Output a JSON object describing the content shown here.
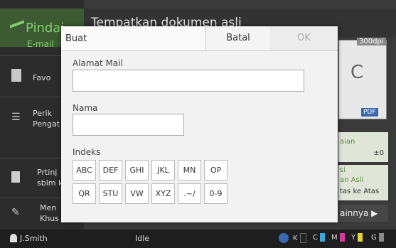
{
  "side": {
    "scan_title": "Pindai",
    "scan_sub": "E-mail",
    "items": [
      {
        "label": "Favo"
      },
      {
        "label": "Perik\nPengat"
      },
      {
        "label": "Prtinj\nsblm k"
      },
      {
        "label": "Men\nKhus"
      }
    ]
  },
  "topbar": {
    "title": "Tempatkan dokumen asli"
  },
  "right": {
    "dpi": "300dpi",
    "pdf": "PDF",
    "box1": "aian",
    "box1_val": "±0",
    "box2_l1": "si",
    "box2_l2": "an Asli",
    "box2_l3": "tas ke Atas",
    "lainnya": "ainnya ▶"
  },
  "status": {
    "user": "J.Smith",
    "state": "Idle",
    "toner": [
      "K",
      "C",
      "M",
      "Y",
      "G"
    ],
    "colors": {
      "K": "#222222",
      "C": "#3ea8d8",
      "M": "#d03aa0",
      "Y": "#e6d23a",
      "G": "#888888"
    }
  },
  "dialog": {
    "title": "Buat",
    "cancel": "Batal",
    "ok": "OK",
    "email_label": "Alamat Mail",
    "email_value": "",
    "name_label": "Nama",
    "name_value": "",
    "index_label": "Indeks",
    "index_keys": [
      "ABC",
      "DEF",
      "GHI",
      "JKL",
      "MN",
      "OP",
      "QR",
      "STU",
      "VW",
      "XYZ",
      ".~/",
      "0-9"
    ]
  }
}
